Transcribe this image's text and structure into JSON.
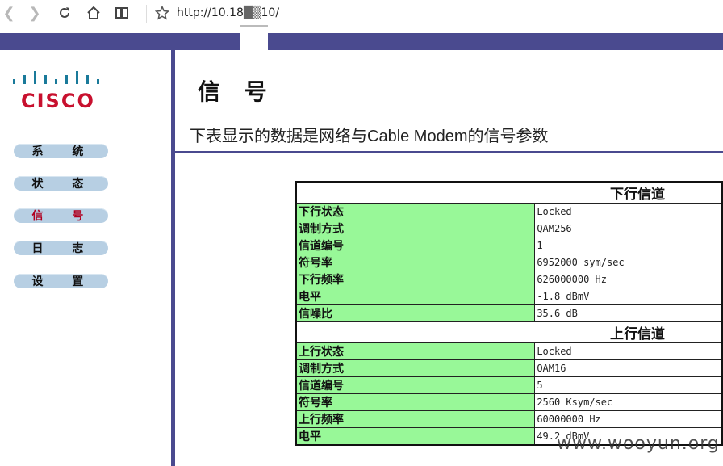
{
  "browser": {
    "url_visible": "http://10.18",
    "url_tail": "10/"
  },
  "sidebar": {
    "logo_word": "CISCO",
    "items": [
      {
        "label": "系 统",
        "active": false
      },
      {
        "label": "状 态",
        "active": false
      },
      {
        "label": "信 号",
        "active": true
      },
      {
        "label": "日 志",
        "active": false
      },
      {
        "label": "设 置",
        "active": false
      }
    ]
  },
  "main": {
    "title": "信 号",
    "description": "下表显示的数据是网络与Cable Modem的信号参数"
  },
  "downstream": {
    "header": "下行信道",
    "rows": [
      {
        "label": "下行状态",
        "value": "Locked"
      },
      {
        "label": "调制方式",
        "value": "QAM256"
      },
      {
        "label": "信道编号",
        "value": "1"
      },
      {
        "label": "符号率",
        "value": "6952000 sym/sec"
      },
      {
        "label": "下行频率",
        "value": "626000000 Hz"
      },
      {
        "label": "电平",
        "value": "-1.8 dBmV"
      },
      {
        "label": "信噪比",
        "value": "35.6 dB"
      }
    ]
  },
  "upstream": {
    "header": "上行信道",
    "rows": [
      {
        "label": "上行状态",
        "value": "Locked"
      },
      {
        "label": "调制方式",
        "value": "QAM16"
      },
      {
        "label": "信道编号",
        "value": "5"
      },
      {
        "label": "符号率",
        "value": "2560 Ksym/sec"
      },
      {
        "label": "上行频率",
        "value": "60000000 Hz"
      },
      {
        "label": "电平",
        "value": "49.2 dBmV"
      }
    ]
  },
  "watermark": "www.wooyun.org",
  "colors": {
    "header_bar": "#4a4a8f",
    "label_cell": "#98f898",
    "nav_button": "#b7cfe3",
    "nav_active_text": "#b00020",
    "logo_red": "#c8102e",
    "logo_teal": "#1a7a9a"
  },
  "icons": [
    "back-icon",
    "forward-icon",
    "reload-icon",
    "home-icon",
    "reader-view-icon",
    "bookmark-star-icon"
  ]
}
